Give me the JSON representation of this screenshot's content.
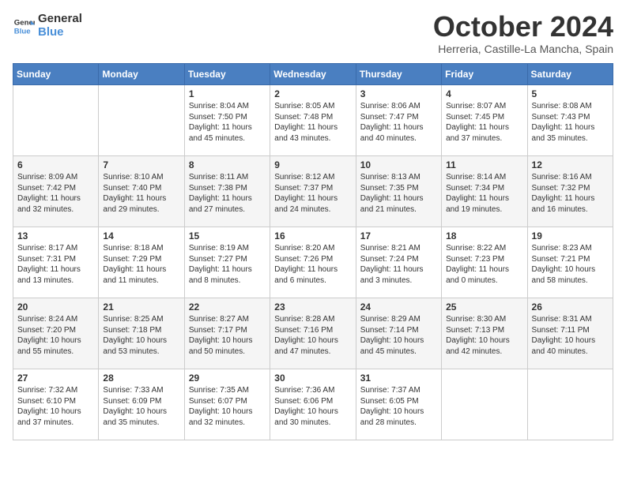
{
  "logo": {
    "line1": "General",
    "line2": "Blue"
  },
  "title": "October 2024",
  "subtitle": "Herreria, Castille-La Mancha, Spain",
  "days_header": [
    "Sunday",
    "Monday",
    "Tuesday",
    "Wednesday",
    "Thursday",
    "Friday",
    "Saturday"
  ],
  "weeks": [
    [
      {
        "day": "",
        "info": ""
      },
      {
        "day": "",
        "info": ""
      },
      {
        "day": "1",
        "info": "Sunrise: 8:04 AM\nSunset: 7:50 PM\nDaylight: 11 hours and 45 minutes."
      },
      {
        "day": "2",
        "info": "Sunrise: 8:05 AM\nSunset: 7:48 PM\nDaylight: 11 hours and 43 minutes."
      },
      {
        "day": "3",
        "info": "Sunrise: 8:06 AM\nSunset: 7:47 PM\nDaylight: 11 hours and 40 minutes."
      },
      {
        "day": "4",
        "info": "Sunrise: 8:07 AM\nSunset: 7:45 PM\nDaylight: 11 hours and 37 minutes."
      },
      {
        "day": "5",
        "info": "Sunrise: 8:08 AM\nSunset: 7:43 PM\nDaylight: 11 hours and 35 minutes."
      }
    ],
    [
      {
        "day": "6",
        "info": "Sunrise: 8:09 AM\nSunset: 7:42 PM\nDaylight: 11 hours and 32 minutes."
      },
      {
        "day": "7",
        "info": "Sunrise: 8:10 AM\nSunset: 7:40 PM\nDaylight: 11 hours and 29 minutes."
      },
      {
        "day": "8",
        "info": "Sunrise: 8:11 AM\nSunset: 7:38 PM\nDaylight: 11 hours and 27 minutes."
      },
      {
        "day": "9",
        "info": "Sunrise: 8:12 AM\nSunset: 7:37 PM\nDaylight: 11 hours and 24 minutes."
      },
      {
        "day": "10",
        "info": "Sunrise: 8:13 AM\nSunset: 7:35 PM\nDaylight: 11 hours and 21 minutes."
      },
      {
        "day": "11",
        "info": "Sunrise: 8:14 AM\nSunset: 7:34 PM\nDaylight: 11 hours and 19 minutes."
      },
      {
        "day": "12",
        "info": "Sunrise: 8:16 AM\nSunset: 7:32 PM\nDaylight: 11 hours and 16 minutes."
      }
    ],
    [
      {
        "day": "13",
        "info": "Sunrise: 8:17 AM\nSunset: 7:31 PM\nDaylight: 11 hours and 13 minutes."
      },
      {
        "day": "14",
        "info": "Sunrise: 8:18 AM\nSunset: 7:29 PM\nDaylight: 11 hours and 11 minutes."
      },
      {
        "day": "15",
        "info": "Sunrise: 8:19 AM\nSunset: 7:27 PM\nDaylight: 11 hours and 8 minutes."
      },
      {
        "day": "16",
        "info": "Sunrise: 8:20 AM\nSunset: 7:26 PM\nDaylight: 11 hours and 6 minutes."
      },
      {
        "day": "17",
        "info": "Sunrise: 8:21 AM\nSunset: 7:24 PM\nDaylight: 11 hours and 3 minutes."
      },
      {
        "day": "18",
        "info": "Sunrise: 8:22 AM\nSunset: 7:23 PM\nDaylight: 11 hours and 0 minutes."
      },
      {
        "day": "19",
        "info": "Sunrise: 8:23 AM\nSunset: 7:21 PM\nDaylight: 10 hours and 58 minutes."
      }
    ],
    [
      {
        "day": "20",
        "info": "Sunrise: 8:24 AM\nSunset: 7:20 PM\nDaylight: 10 hours and 55 minutes."
      },
      {
        "day": "21",
        "info": "Sunrise: 8:25 AM\nSunset: 7:18 PM\nDaylight: 10 hours and 53 minutes."
      },
      {
        "day": "22",
        "info": "Sunrise: 8:27 AM\nSunset: 7:17 PM\nDaylight: 10 hours and 50 minutes."
      },
      {
        "day": "23",
        "info": "Sunrise: 8:28 AM\nSunset: 7:16 PM\nDaylight: 10 hours and 47 minutes."
      },
      {
        "day": "24",
        "info": "Sunrise: 8:29 AM\nSunset: 7:14 PM\nDaylight: 10 hours and 45 minutes."
      },
      {
        "day": "25",
        "info": "Sunrise: 8:30 AM\nSunset: 7:13 PM\nDaylight: 10 hours and 42 minutes."
      },
      {
        "day": "26",
        "info": "Sunrise: 8:31 AM\nSunset: 7:11 PM\nDaylight: 10 hours and 40 minutes."
      }
    ],
    [
      {
        "day": "27",
        "info": "Sunrise: 7:32 AM\nSunset: 6:10 PM\nDaylight: 10 hours and 37 minutes."
      },
      {
        "day": "28",
        "info": "Sunrise: 7:33 AM\nSunset: 6:09 PM\nDaylight: 10 hours and 35 minutes."
      },
      {
        "day": "29",
        "info": "Sunrise: 7:35 AM\nSunset: 6:07 PM\nDaylight: 10 hours and 32 minutes."
      },
      {
        "day": "30",
        "info": "Sunrise: 7:36 AM\nSunset: 6:06 PM\nDaylight: 10 hours and 30 minutes."
      },
      {
        "day": "31",
        "info": "Sunrise: 7:37 AM\nSunset: 6:05 PM\nDaylight: 10 hours and 28 minutes."
      },
      {
        "day": "",
        "info": ""
      },
      {
        "day": "",
        "info": ""
      }
    ]
  ]
}
